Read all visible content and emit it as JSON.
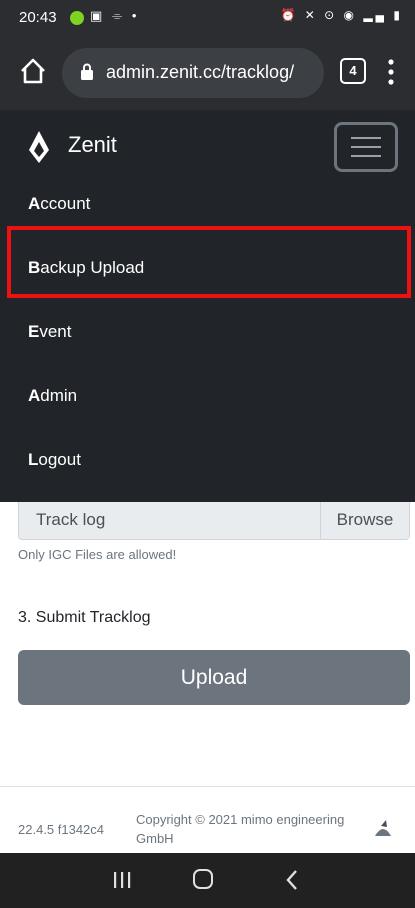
{
  "status_bar": {
    "time": "20:43",
    "left_icons": "▣ ⌯ •",
    "right_icons": "⏰ ✕ ⊙ ◉ ▂▄ ▮"
  },
  "browser": {
    "url": "admin.zenit.cc/tracklog/",
    "tab_count": "4"
  },
  "navbar": {
    "brand": "Zenit",
    "items": [
      {
        "first": "A",
        "rest": "ccount"
      },
      {
        "first": "B",
        "rest": "ackup Upload"
      },
      {
        "first": "E",
        "rest": "vent"
      },
      {
        "first": "A",
        "rest": "dmin"
      },
      {
        "first": "L",
        "rest": "ogout"
      }
    ],
    "highlight_color": "#ee1111"
  },
  "form": {
    "file_label": "Track log",
    "browse": "Browse",
    "help": "Only IGC Files are allowed!",
    "step_title": "3. Submit Tracklog",
    "upload": "Upload"
  },
  "footer": {
    "version": "22.4.5 f1342c4",
    "copyright": "Copyright © 2021 mimo engineering GmbH"
  }
}
